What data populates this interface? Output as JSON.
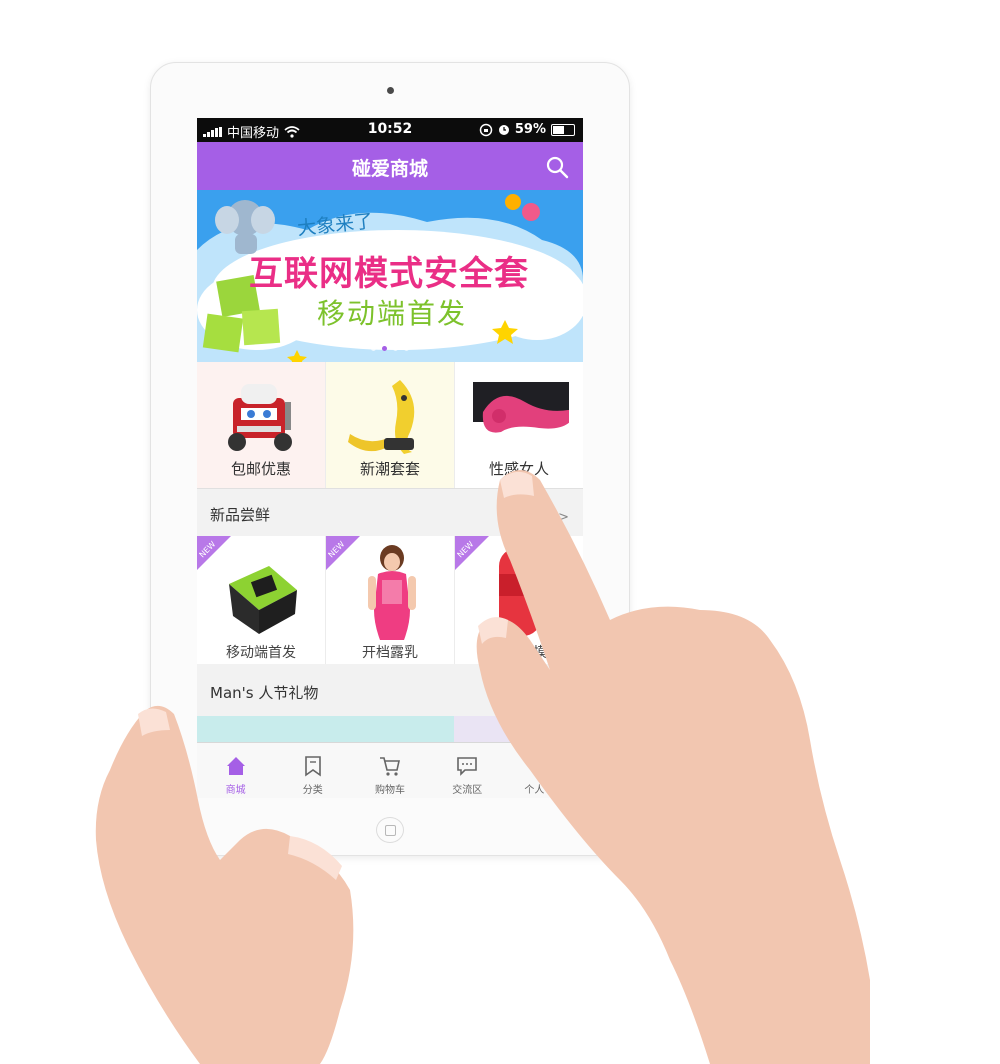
{
  "status_bar": {
    "carrier": "中国移动",
    "time": "10:52",
    "battery": "59%",
    "battery_level": 0.59
  },
  "app_bar": {
    "title": "碰爱商城"
  },
  "banner": {
    "line1": "大象来了",
    "line2": "互联网模式安全套",
    "line3": "移动端首发",
    "slides": 4,
    "active_slide": 2
  },
  "categories": [
    {
      "label": "包邮优惠",
      "icon": "truck-image"
    },
    {
      "label": "新潮套套",
      "icon": "banana-image"
    },
    {
      "label": "性感女人",
      "icon": "pink-product-image"
    }
  ],
  "new_section": {
    "title": "新品尝鲜",
    "more": "显示更多 >",
    "badge": "NEW",
    "products": [
      {
        "label": "移动端首发",
        "icon": "green-box-image"
      },
      {
        "label": "开档露乳",
        "icon": "lingerie-model-image"
      },
      {
        "label": "真人倒模",
        "icon": "red-cup-image"
      }
    ]
  },
  "gift_section": {
    "title": "Man's 人节礼物"
  },
  "tabbar": {
    "items": [
      {
        "label": "商城",
        "icon": "home-icon",
        "active": true
      },
      {
        "label": "分类",
        "icon": "bookmark-icon",
        "active": false
      },
      {
        "label": "购物车",
        "icon": "cart-icon",
        "active": false
      },
      {
        "label": "交流区",
        "icon": "chat-icon",
        "active": false
      },
      {
        "label": "个人中心",
        "icon": "user-icon",
        "active": false
      }
    ]
  },
  "colors": {
    "accent": "#a55fe6",
    "banner_bg": "#3aa0ee",
    "headline": "#ea2e86",
    "subline": "#7dc22c"
  }
}
